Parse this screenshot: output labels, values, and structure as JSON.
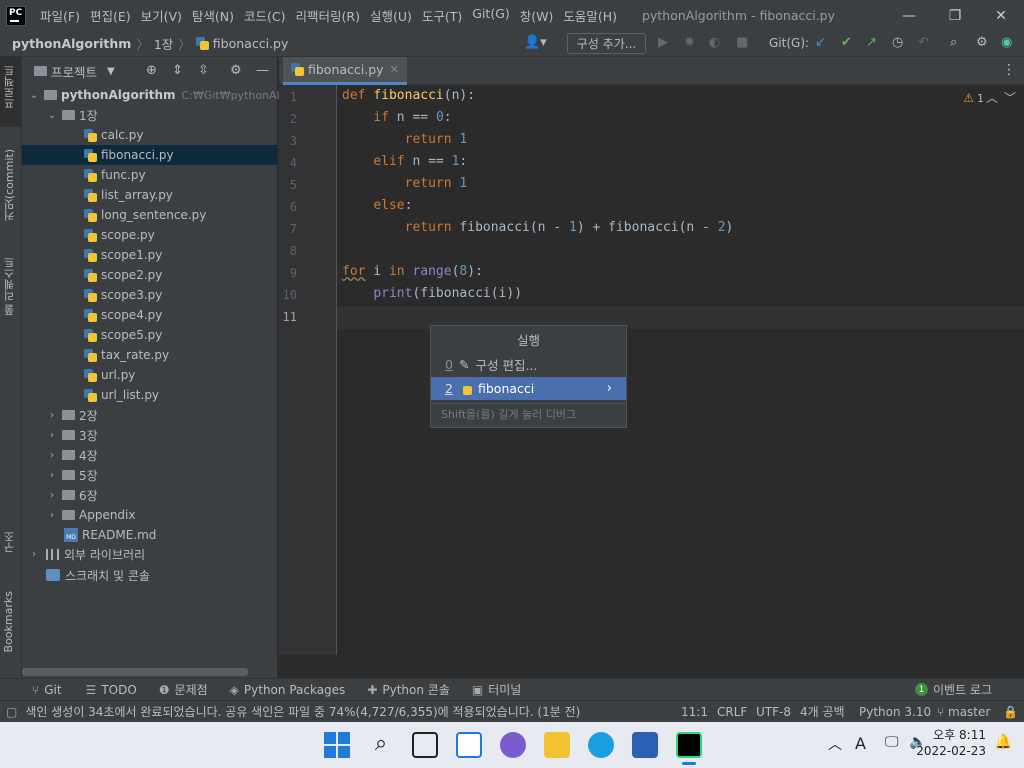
{
  "window": {
    "title": "pythonAlgorithm - fibonacci.py",
    "logo_text": "PC",
    "menu": [
      "파일(F)",
      "편집(E)",
      "보기(V)",
      "탐색(N)",
      "코드(C)",
      "리팩터링(R)",
      "실행(U)",
      "도구(T)",
      "Git(G)",
      "창(W)",
      "도움말(H)"
    ],
    "controls": {
      "minimize": "—",
      "restore": "❐",
      "close": "✕"
    }
  },
  "navbar": {
    "project": "pythonAlgorithm",
    "folder": "1장",
    "file": "fibonacci.py",
    "run_config": "구성 추가...",
    "git_label": "Git(G):"
  },
  "left_stripe": {
    "project": "프로젝트",
    "commit": "커밋(commit)",
    "pull_requests": "풀 리퀘스트",
    "structure": "구조",
    "bookmarks": "Bookmarks"
  },
  "project_panel": {
    "header": "프로젝트",
    "root": "pythonAlgorithm",
    "root_path": "C:₩Git₩pythonAlgo",
    "folder1": "1장",
    "files": [
      "calc.py",
      "fibonacci.py",
      "func.py",
      "list_array.py",
      "long_sentence.py",
      "scope.py",
      "scope1.py",
      "scope2.py",
      "scope3.py",
      "scope4.py",
      "scope5.py",
      "tax_rate.py",
      "url.py",
      "url_list.py"
    ],
    "folders": [
      "2장",
      "3장",
      "4장",
      "5장",
      "6장",
      "Appendix"
    ],
    "readme": "README.md",
    "md_badge": "MD",
    "ext_libs": "외부 라이브러리",
    "scratches": "스크래치 및 콘솔"
  },
  "editor": {
    "tab": "fibonacci.py",
    "warning_count": "1",
    "line_numbers": [
      "1",
      "2",
      "3",
      "4",
      "5",
      "6",
      "7",
      "8",
      "9",
      "10",
      "11"
    ]
  },
  "popup": {
    "title": "실행",
    "items": [
      {
        "num": "0",
        "label": "구성 편집..."
      },
      {
        "num": "2",
        "label": "fibonacci"
      }
    ],
    "hint": "Shift을(를) 길게 눌러 디버그"
  },
  "bottom_tools": [
    "Git",
    "TODO",
    "문제점",
    "Python Packages",
    "Python 콘솔",
    "터미널"
  ],
  "events": {
    "label": "이벤트 로그",
    "count": "1"
  },
  "status": {
    "message": "색인 생성이 34초에서 완료되었습니다. 공유 색인은 파일 중 74%(4,727/6,355)에 적용되었습니다. (1분 전)",
    "position": "11:1",
    "line_sep": "CRLF",
    "encoding": "UTF-8",
    "indent": "4개 공백",
    "interpreter": "Python 3.10",
    "branch": "master"
  },
  "taskbar": {
    "time": "오후 8:11",
    "date": "2022-02-23",
    "ime": "A"
  },
  "colors": {
    "accent": "#4b6eaf",
    "selection": "#0d293e",
    "keyword": "#cc7832",
    "function": "#ffc66d",
    "number": "#6897bb"
  }
}
